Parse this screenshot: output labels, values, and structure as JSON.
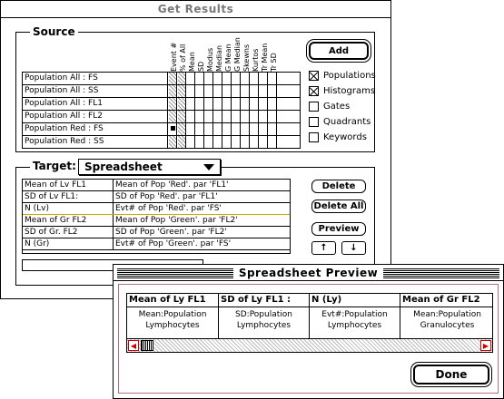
{
  "main_window": {
    "title": "Get Results",
    "source": {
      "label": "Source",
      "columns": [
        "Event #",
        "% of All",
        "Mean",
        "SD",
        "Modus",
        "Median",
        "G Mean",
        "G Median",
        "Skewns",
        "Kurtos",
        "Tr Mean",
        "Tr SD"
      ],
      "rows": [
        {
          "label": "Population All : FS"
        },
        {
          "label": "Population All : SS"
        },
        {
          "label": "Population All : FL1"
        },
        {
          "label": "Population All : FL2"
        },
        {
          "label": "Population Red : FS"
        },
        {
          "label": "Population Red : SS"
        }
      ],
      "add_button": "Add",
      "checkboxes": [
        {
          "label": "Populations",
          "checked": true
        },
        {
          "label": "Histograms",
          "checked": true
        },
        {
          "label": "Gates",
          "checked": false
        },
        {
          "label": "Quadrants",
          "checked": false
        },
        {
          "label": "Keywords",
          "checked": false
        }
      ]
    },
    "target": {
      "label": "Target:",
      "popup_value": "Spreadsheet",
      "rows": [
        {
          "name": "Mean of Lv FL1",
          "value": "Mean of Pop 'Red'. par 'FL1'"
        },
        {
          "name": "SD of Lv FL1:",
          "value": "SD of Pop 'Red'. par 'FL1'"
        },
        {
          "name": "N (Lv)",
          "value": "Evt# of Pop 'Red'. par 'FS'"
        },
        {
          "name": "Mean of Gr FL2",
          "value": "Mean of Pop 'Green'. par 'FL2'"
        },
        {
          "name": "SD of Gr. FL2",
          "value": "SD of Pop 'Green'. par 'FL2'"
        },
        {
          "name": "N (Gr)",
          "value": "Evt# of Pop 'Green'. par 'FS'"
        }
      ],
      "delete_button": "Delete",
      "delete_all_button": "Delete All",
      "preview_button": "Preview",
      "up_arrow": "↑",
      "down_arrow": "↓"
    }
  },
  "preview_window": {
    "title": "Spreadsheet Preview",
    "columns": [
      {
        "header": "Mean of Ly FL1",
        "line1": "Mean:Population",
        "line2": "Lymphocytes"
      },
      {
        "header": "SD of Ly FL1 :",
        "line1": "SD:Population",
        "line2": "Lymphocytes"
      },
      {
        "header": "N (Ly)",
        "line1": "Evt#:Population",
        "line2": "Lymphocytes"
      },
      {
        "header": "Mean of Gr FL2",
        "line1": "Mean:Population",
        "line2": "Granulocytes"
      }
    ],
    "done_button": "Done",
    "scroll_left_icon": "◀",
    "scroll_right_icon": "▶",
    "accent_color": "#cc0000"
  }
}
